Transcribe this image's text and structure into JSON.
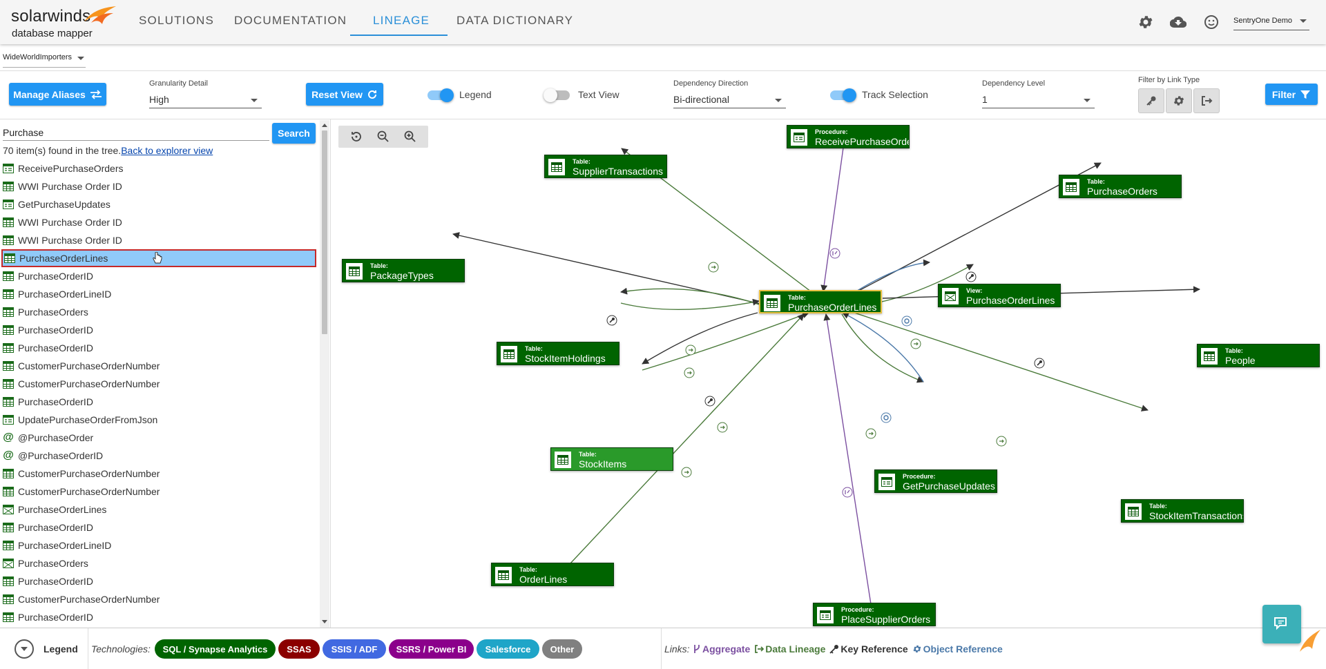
{
  "app": {
    "logo_main": "solarwinds",
    "logo_sub": "database mapper",
    "nav": [
      "SOLUTIONS",
      "DOCUMENTATION",
      "LINEAGE",
      "DATA DICTIONARY"
    ],
    "active_tab": "LINEAGE",
    "user": "SentryOne Demo",
    "accent_color": "#2196f3",
    "header_icons": [
      "gear-icon",
      "cloud-download-icon",
      "smiley-icon"
    ]
  },
  "database": {
    "selected": "WideWorldImporters"
  },
  "toolbar": {
    "manage_aliases": "Manage Aliases",
    "granularity_label": "Granularity Detail",
    "granularity_value": "High",
    "reset_view": "Reset View",
    "legend_label": "Legend",
    "legend_on": true,
    "textview_label": "Text View",
    "textview_on": false,
    "direction_label": "Dependency Direction",
    "direction_value": "Bi-directional",
    "track_label": "Track Selection",
    "track_on": true,
    "level_label": "Dependency Level",
    "level_value": "1",
    "filter_link_label": "Filter by Link Type",
    "filter_button": "Filter"
  },
  "search": {
    "value": "Purchase",
    "button": "Search",
    "count_text": "70 item(s) found in the tree.",
    "back_link": "Back to explorer view"
  },
  "tree": [
    {
      "icon": "procedure-icon",
      "label": "ReceivePurchaseOrders"
    },
    {
      "icon": "table-icon",
      "label": "WWI Purchase Order ID"
    },
    {
      "icon": "procedure-icon",
      "label": "GetPurchaseUpdates"
    },
    {
      "icon": "table-icon",
      "label": "WWI Purchase Order ID"
    },
    {
      "icon": "table-icon",
      "label": "WWI Purchase Order ID"
    },
    {
      "icon": "table-icon",
      "label": "PurchaseOrderLines",
      "selected": true
    },
    {
      "icon": "table-icon",
      "label": "PurchaseOrderID"
    },
    {
      "icon": "table-icon",
      "label": "PurchaseOrderLineID"
    },
    {
      "icon": "table-icon",
      "label": "PurchaseOrders"
    },
    {
      "icon": "table-icon",
      "label": "PurchaseOrderID"
    },
    {
      "icon": "table-icon",
      "label": "PurchaseOrderID"
    },
    {
      "icon": "table-icon",
      "label": "CustomerPurchaseOrderNumber"
    },
    {
      "icon": "table-icon",
      "label": "CustomerPurchaseOrderNumber"
    },
    {
      "icon": "table-icon",
      "label": "PurchaseOrderID"
    },
    {
      "icon": "procedure-icon",
      "label": "UpdatePurchaseOrderFromJson"
    },
    {
      "icon": "parameter-icon",
      "label": "@PurchaseOrder"
    },
    {
      "icon": "parameter-icon",
      "label": "@PurchaseOrderID"
    },
    {
      "icon": "table-icon",
      "label": "CustomerPurchaseOrderNumber"
    },
    {
      "icon": "table-icon",
      "label": "CustomerPurchaseOrderNumber"
    },
    {
      "icon": "view-icon",
      "label": "PurchaseOrderLines"
    },
    {
      "icon": "table-icon",
      "label": "PurchaseOrderID"
    },
    {
      "icon": "table-icon",
      "label": "PurchaseOrderLineID"
    },
    {
      "icon": "view-icon",
      "label": "PurchaseOrders"
    },
    {
      "icon": "table-icon",
      "label": "PurchaseOrderID"
    },
    {
      "icon": "table-icon",
      "label": "CustomerPurchaseOrderNumber"
    },
    {
      "icon": "table-icon",
      "label": "PurchaseOrderID"
    }
  ],
  "graph": {
    "nodes": [
      {
        "id": "center",
        "type": "Table:",
        "name": "PurchaseOrderLines",
        "icon": "table-icon"
      },
      {
        "id": "receive",
        "type": "Procedure:",
        "name": "ReceivePurchaseOrders",
        "icon": "procedure-icon"
      },
      {
        "id": "supplier",
        "type": "Table:",
        "name": "SupplierTransactions",
        "icon": "table-icon"
      },
      {
        "id": "porders",
        "type": "Table:",
        "name": "PurchaseOrders",
        "icon": "table-icon"
      },
      {
        "id": "package",
        "type": "Table:",
        "name": "PackageTypes",
        "icon": "table-icon"
      },
      {
        "id": "view",
        "type": "View:",
        "name": "PurchaseOrderLines",
        "icon": "view-icon"
      },
      {
        "id": "holdings",
        "type": "Table:",
        "name": "StockItemHoldings",
        "icon": "table-icon"
      },
      {
        "id": "people",
        "type": "Table:",
        "name": "People",
        "icon": "table-icon"
      },
      {
        "id": "stockitems",
        "type": "Table:",
        "name": "StockItems",
        "icon": "table-icon"
      },
      {
        "id": "getupdates",
        "type": "Procedure:",
        "name": "GetPurchaseUpdates",
        "icon": "procedure-icon"
      },
      {
        "id": "sitrans",
        "type": "Table:",
        "name": "StockItemTransactions",
        "icon": "table-icon"
      },
      {
        "id": "orderlines",
        "type": "Table:",
        "name": "OrderLines",
        "icon": "table-icon"
      },
      {
        "id": "place",
        "type": "Procedure:",
        "name": "PlaceSupplierOrders",
        "icon": "procedure-icon"
      }
    ],
    "link_colors": {
      "aggregate": "#7b4fa0",
      "lineage": "#4a7a3a",
      "key": "#333333",
      "object": "#4a78a8"
    }
  },
  "footer": {
    "legend_label": "Legend",
    "technologies_label": "Technologies:",
    "technologies": [
      {
        "label": "SQL / Synapse Analytics",
        "color": "#006400"
      },
      {
        "label": "SSAS",
        "color": "#8b0000"
      },
      {
        "label": "SSIS / ADF",
        "color": "#4169e1"
      },
      {
        "label": "SSRS / Power BI",
        "color": "#8b008b"
      },
      {
        "label": "Salesforce",
        "color": "#1fa5c8"
      },
      {
        "label": "Other",
        "color": "#808080"
      }
    ],
    "links_label": "Links:",
    "links": [
      {
        "label": "Aggregate",
        "icon": "fork-icon",
        "color": "#7b4fa0"
      },
      {
        "label": "Data Lineage",
        "icon": "exit-icon",
        "color": "#4a7a3a"
      },
      {
        "label": "Key Reference",
        "icon": "key-icon",
        "color": "#333333"
      },
      {
        "label": "Object Reference",
        "icon": "gear-icon",
        "color": "#4a78a8"
      }
    ]
  }
}
